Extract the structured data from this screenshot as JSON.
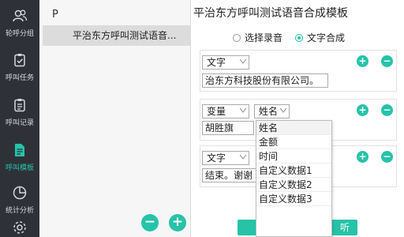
{
  "nav": {
    "items": [
      {
        "label": "轮呼分组",
        "icon": "users-icon"
      },
      {
        "label": "呼叫任务",
        "icon": "clipboard-check-icon"
      },
      {
        "label": "呼叫记录",
        "icon": "clipboard-list-icon"
      },
      {
        "label": "呼叫模板",
        "icon": "document-icon",
        "active": true
      },
      {
        "label": "统计分析",
        "icon": "pie-chart-icon"
      },
      {
        "label": "",
        "icon": "gear-icon"
      }
    ],
    "accent_color": "#26c3a9",
    "background": "#2e3238"
  },
  "list_panel": {
    "search_text": "P",
    "items": [
      "平治东方呼叫测试语音..."
    ]
  },
  "main": {
    "title": "平治东方呼叫测试语音合成模板",
    "radios": [
      {
        "label": "选择录音",
        "checked": false
      },
      {
        "label": "文字合成",
        "checked": true
      }
    ],
    "rows": [
      {
        "type": "文字",
        "text": "治东方科技股份有限公司。"
      },
      {
        "type": "变量",
        "variable": "姓名",
        "text": "胡胜旗"
      },
      {
        "type": "文字",
        "text": "结束。谢谢"
      }
    ],
    "dropdown_options": [
      "姓名",
      "金额",
      "时间",
      "自定义数据1",
      "自定义数据2",
      "自定义数据3"
    ],
    "bottom_button_tail": "听"
  }
}
